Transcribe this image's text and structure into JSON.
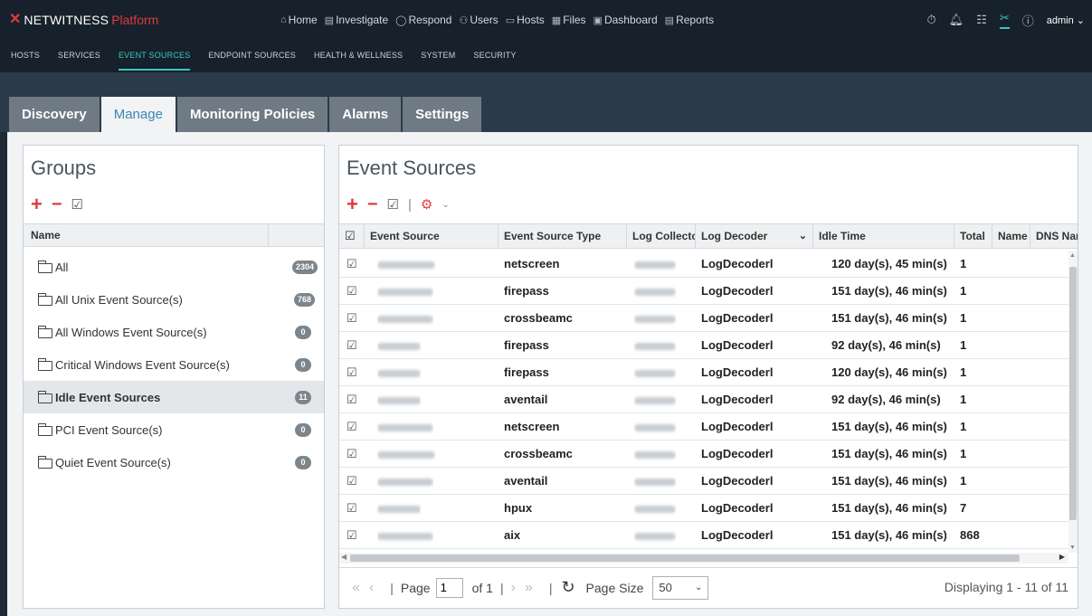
{
  "app": {
    "logo_mark": "✕",
    "brand": "NETWITNESS",
    "product": "Platform",
    "nav": [
      {
        "icon": "⌂",
        "icon_name": "home-icon",
        "label": "Home"
      },
      {
        "icon": "▤",
        "icon_name": "investigate-icon",
        "label": "Investigate"
      },
      {
        "icon": "◯",
        "icon_name": "respond-icon",
        "label": "Respond"
      },
      {
        "icon": "⚇",
        "icon_name": "users-icon",
        "label": "Users"
      },
      {
        "icon": "▭",
        "icon_name": "hosts-icon",
        "label": "Hosts"
      },
      {
        "icon": "▦",
        "icon_name": "files-icon",
        "label": "Files"
      },
      {
        "icon": "▣",
        "icon_name": "dashboard-icon",
        "label": "Dashboard"
      },
      {
        "icon": "▤",
        "icon_name": "reports-icon",
        "label": "Reports"
      }
    ],
    "user": "admin"
  },
  "subnav": [
    "HOSTS",
    "SERVICES",
    "EVENT SOURCES",
    "ENDPOINT SOURCES",
    "HEALTH & WELLNESS",
    "SYSTEM",
    "SECURITY"
  ],
  "subnav_active": "EVENT SOURCES",
  "tabs": [
    "Discovery",
    "Manage",
    "Monitoring Policies",
    "Alarms",
    "Settings"
  ],
  "tab_active": "Manage",
  "groups": {
    "title": "Groups",
    "column_name": "Name",
    "items": [
      {
        "name": "All",
        "count": "2304"
      },
      {
        "name": "All Unix Event Source(s)",
        "count": "768"
      },
      {
        "name": "All Windows Event Source(s)",
        "count": "0"
      },
      {
        "name": "Critical Windows Event Source(s)",
        "count": "0"
      },
      {
        "name": "Idle Event Sources",
        "count": "11"
      },
      {
        "name": "PCI Event Source(s)",
        "count": "0"
      },
      {
        "name": "Quiet Event Source(s)",
        "count": "0"
      }
    ],
    "selected": "Idle Event Sources"
  },
  "sources": {
    "title": "Event Sources",
    "columns": [
      "Event Source",
      "Event Source Type",
      "Log Collector",
      "Log Decoder",
      "Idle Time",
      "Total",
      "Name",
      "DNS Name"
    ],
    "rows": [
      {
        "type": "netscreen",
        "decoder": "LogDecoderl",
        "idle": "120 day(s), 45 min(s)",
        "total": "1"
      },
      {
        "type": "firepass",
        "decoder": "LogDecoderl",
        "idle": "151 day(s), 46 min(s)",
        "total": "1"
      },
      {
        "type": "crossbeamc",
        "decoder": "LogDecoderl",
        "idle": "151 day(s), 46 min(s)",
        "total": "1"
      },
      {
        "type": "firepass",
        "decoder": "LogDecoderl",
        "idle": "92 day(s), 46 min(s)",
        "total": "1"
      },
      {
        "type": "firepass",
        "decoder": "LogDecoderl",
        "idle": "120 day(s), 46 min(s)",
        "total": "1"
      },
      {
        "type": "aventail",
        "decoder": "LogDecoderl",
        "idle": "92 day(s), 46 min(s)",
        "total": "1"
      },
      {
        "type": "netscreen",
        "decoder": "LogDecoderl",
        "idle": "151 day(s), 46 min(s)",
        "total": "1"
      },
      {
        "type": "crossbeamc",
        "decoder": "LogDecoderl",
        "idle": "151 day(s), 46 min(s)",
        "total": "1"
      },
      {
        "type": "aventail",
        "decoder": "LogDecoderl",
        "idle": "151 day(s), 46 min(s)",
        "total": "1"
      },
      {
        "type": "hpux",
        "decoder": "LogDecoderl",
        "idle": "151 day(s), 46 min(s)",
        "total": "7"
      },
      {
        "type": "aix",
        "decoder": "LogDecoderl",
        "idle": "151 day(s), 46 min(s)",
        "total": "868"
      }
    ]
  },
  "pager": {
    "page_label": "Page",
    "page_value": "1",
    "of_label": "of 1",
    "size_label": "Page Size",
    "size_value": "50",
    "display": "Displaying 1 - 11 of 11"
  }
}
